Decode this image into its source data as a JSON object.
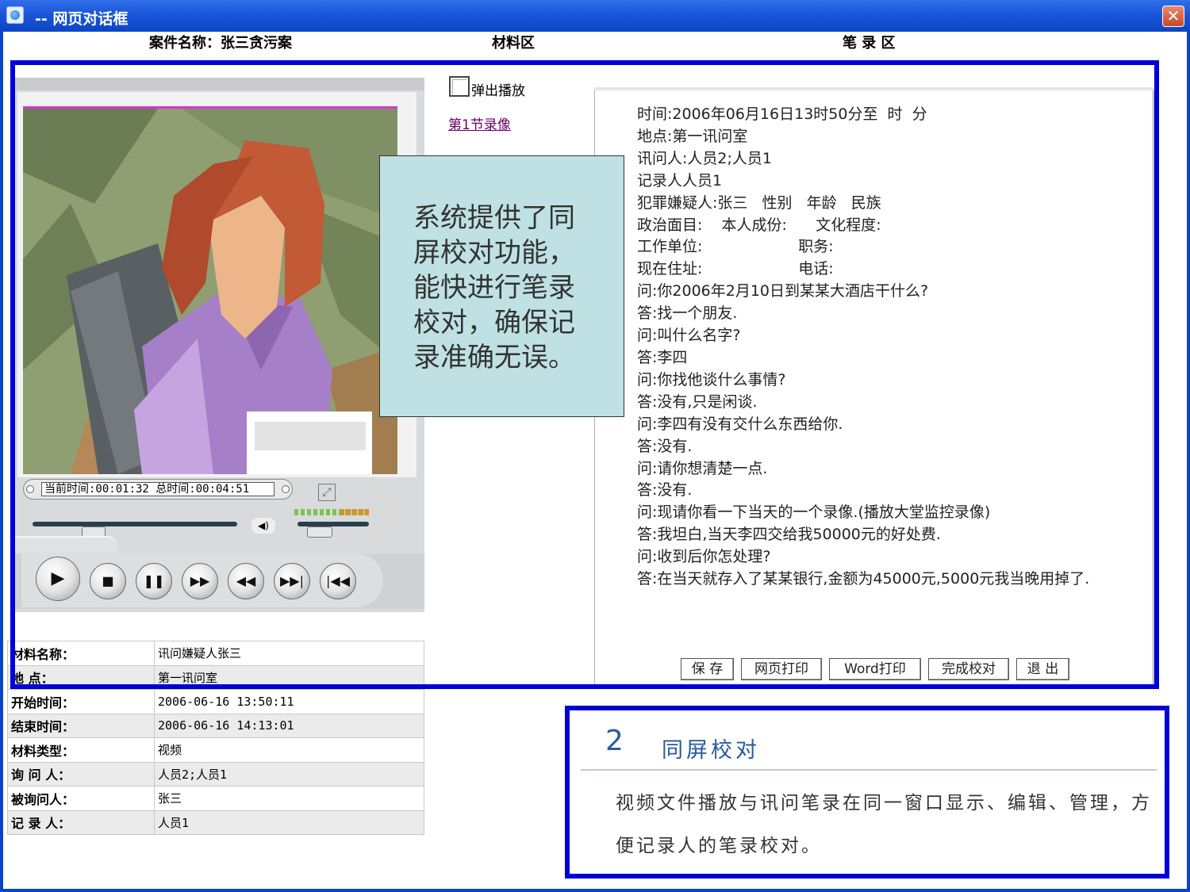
{
  "window": {
    "title": "-- 网页对话框",
    "close_glyph": "✕"
  },
  "header": {
    "case_name": "案件名称：张三贪污案",
    "material_area": "材料区",
    "record_area": "笔 录 区"
  },
  "player": {
    "time_display": "当前时间:00:01:32 总时间:00:04:51",
    "seek_progress": 0.27,
    "volume_level": 0.2,
    "icons": [
      "play-icon",
      "stop-icon",
      "pause-icon",
      "fast-forward-icon",
      "rewind-icon",
      "next-track-icon",
      "previous-track-icon",
      "volume-icon",
      "fullscreen-icon"
    ]
  },
  "materials": {
    "popup_label": "弹出播放",
    "recording_link": "第1节录像"
  },
  "callout": {
    "text": "系统提供了同屏校对功能，能快进行笔录校对，确保记录准确无误。"
  },
  "transcript": {
    "lines": [
      "时间:2006年06月16日13时50分至  时  分",
      "地点:第一讯问室",
      "讯问人:人员2;人员1",
      "记录人人员1",
      "犯罪嫌疑人:张三   性别   年龄   民族",
      "政治面目:    本人成份:      文化程度:",
      "工作单位:                    职务:",
      "现在住址:                    电话:",
      "问:你2006年2月10日到某某大酒店干什么?",
      "答:找一个朋友.",
      "问:叫什么名字?",
      "答:李四",
      "问:你找他谈什么事情?",
      "答:没有,只是闲谈.",
      "问:李四有没有交什么东西给你.",
      "答:没有.",
      "问:请你想清楚一点.",
      "答:没有.",
      "问:现请你看一下当天的一个录像.(播放大堂监控录像)",
      "答:我坦白,当天李四交给我50000元的好处费.",
      "问:收到后你怎处理?",
      "答:在当天就存入了某某银行,金额为45000元,5000元我当晚用掉了."
    ],
    "buttons": {
      "save": "保 存",
      "web_print": "网页打印",
      "word_print": "Word打印",
      "finish_proofread": "完成校对",
      "exit": "退 出"
    }
  },
  "info_table": {
    "rows": [
      {
        "label": "材料名称：",
        "value": "讯问嫌疑人张三"
      },
      {
        "label": "地    点：",
        "value": "第一讯问室"
      },
      {
        "label": "开始时间：",
        "value": "2006-06-16 13:50:11"
      },
      {
        "label": "结束时间：",
        "value": "2006-06-16 14:13:01"
      },
      {
        "label": "材料类型：",
        "value": "视频"
      },
      {
        "label": "询 问 人：",
        "value": "人员2;人员1"
      },
      {
        "label": "被询问人：",
        "value": "张三"
      },
      {
        "label": "记 录 人：",
        "value": "人员1"
      }
    ]
  },
  "feature": {
    "number": "2",
    "title": "同屏校对",
    "description": "视频文件播放与讯问笔录在同一窗口显示、编辑、管理，方便记录人的笔录校对。"
  },
  "colors": {
    "titlebar": "#1a56d8",
    "highlight_frame": "#0000d8",
    "callout_bg": "#bfe1e3",
    "link": "#6a006a",
    "feature_text": "#2a5a9a"
  }
}
